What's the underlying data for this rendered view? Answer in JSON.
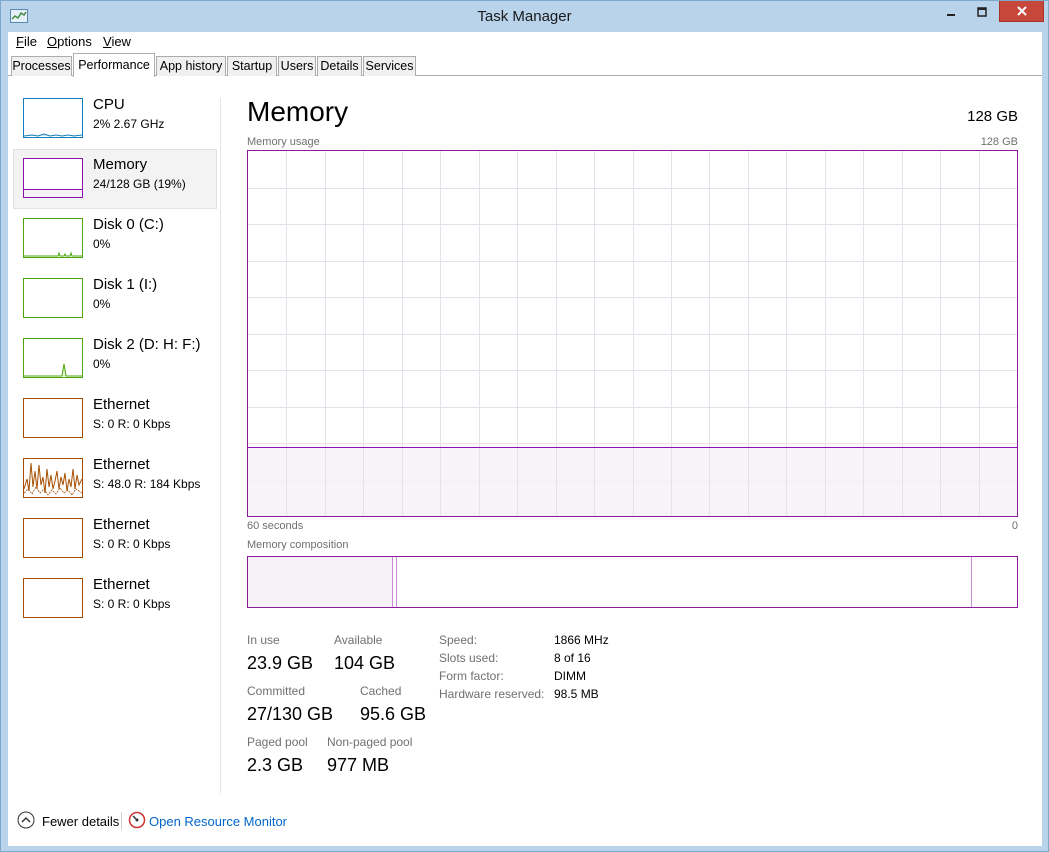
{
  "window": {
    "title": "Task Manager"
  },
  "menu": [
    {
      "label": "File",
      "accel": "F",
      "rest": "ile"
    },
    {
      "label": "Options",
      "accel": "O",
      "rest": "ptions"
    },
    {
      "label": "View",
      "accel": "V",
      "rest": "iew"
    }
  ],
  "tabs": [
    "Processes",
    "Performance",
    "App history",
    "Startup",
    "Users",
    "Details",
    "Services"
  ],
  "active_tab": "Performance",
  "sidebar": [
    {
      "title": "CPU",
      "sub": "2% 2.67 GHz",
      "color": "#117dbb"
    },
    {
      "title": "Memory",
      "sub": "24/128 GB (19%)",
      "color": "#8b12ae",
      "usage": 0.19
    },
    {
      "title": "Disk 0 (C:)",
      "sub": "0%",
      "color": "#4da60c"
    },
    {
      "title": "Disk 1 (I:)",
      "sub": "0%",
      "color": "#4da60c"
    },
    {
      "title": "Disk 2 (D: H: F:)",
      "sub": "0%",
      "color": "#4da60c"
    },
    {
      "title": "Ethernet",
      "sub": "S: 0 R: 0 Kbps",
      "color": "#a74f01"
    },
    {
      "title": "Ethernet",
      "sub": "S: 48.0 R: 184 Kbps",
      "color": "#a74f01"
    },
    {
      "title": "Ethernet",
      "sub": "S: 0 R: 0 Kbps",
      "color": "#a74f01"
    },
    {
      "title": "Ethernet",
      "sub": "S: 0 R: 0 Kbps",
      "color": "#a74f01"
    }
  ],
  "main": {
    "title": "Memory",
    "total": "128 GB",
    "usage_label": "Memory usage",
    "usage_max": "128 GB",
    "time_left": "60 seconds",
    "time_right": "0",
    "usage_fraction": 0.19,
    "composition_label": "Memory composition",
    "composition": {
      "in_use_fraction": 0.187,
      "modified_fraction": 0.006,
      "standby_fraction": 0.747
    }
  },
  "stats": {
    "in_use": {
      "label": "In use",
      "value": "23.9 GB"
    },
    "available": {
      "label": "Available",
      "value": "104 GB"
    },
    "committed": {
      "label": "Committed",
      "value": "27/130 GB"
    },
    "cached": {
      "label": "Cached",
      "value": "95.6 GB"
    },
    "paged_pool": {
      "label": "Paged pool",
      "value": "2.3 GB"
    },
    "nonpaged_pool": {
      "label": "Non-paged pool",
      "value": "977 MB"
    }
  },
  "details": [
    {
      "label": "Speed:",
      "value": "1866 MHz"
    },
    {
      "label": "Slots used:",
      "value": "8 of 16"
    },
    {
      "label": "Form factor:",
      "value": "DIMM"
    },
    {
      "label": "Hardware reserved:",
      "value": "98.5 MB"
    }
  ],
  "footer": {
    "fewer_details": "Fewer details",
    "fewer_accel": "d",
    "resource_monitor": "Open Resource Monitor"
  },
  "colors": {
    "memory": "#8b12ae",
    "memory_fill": "#f4f2f4",
    "grid": "#e8e0ea",
    "link": "#0066cc"
  }
}
